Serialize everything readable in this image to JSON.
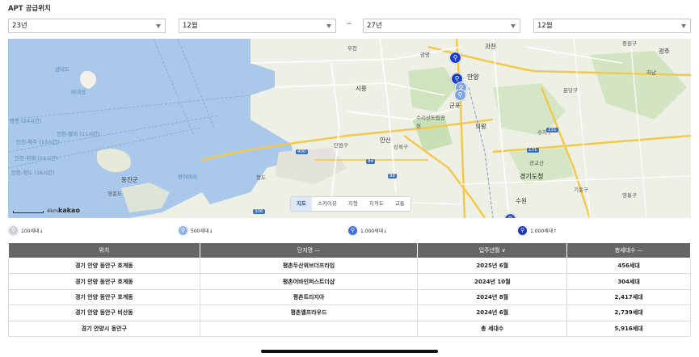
{
  "page": {
    "title": "APT 공급위치"
  },
  "filters": {
    "start_year": "23년",
    "start_month": "12월",
    "separator": "~",
    "end_year": "27년",
    "end_month": "12월"
  },
  "map": {
    "labels": [
      {
        "text": "삼미도",
        "kind": "sea"
      },
      {
        "text": "비내섬",
        "kind": "sea"
      },
      {
        "text": "영종 (24시간)",
        "kind": "sea"
      },
      {
        "text": "인천-팔미 (11시간)",
        "kind": "sea"
      },
      {
        "text": "인천-제주 (13시간)",
        "kind": "sea"
      },
      {
        "text": "인천-청도 (16시간)",
        "kind": "sea"
      },
      {
        "text": "인천-위해 (14시간)",
        "kind": "sea"
      },
      {
        "text": "옹진군",
        "kind": "city"
      },
      {
        "text": "영흥도",
        "kind": "normal"
      },
      {
        "text": "왕어머리",
        "kind": "sea"
      },
      {
        "text": "형도",
        "kind": "normal"
      },
      {
        "text": "시흥",
        "kind": "city"
      },
      {
        "text": "안산",
        "kind": "city"
      },
      {
        "text": "군포",
        "kind": "city"
      },
      {
        "text": "안양",
        "kind": "big"
      },
      {
        "text": "과천",
        "kind": "city"
      },
      {
        "text": "의왕",
        "kind": "city"
      },
      {
        "text": "수원",
        "kind": "city"
      },
      {
        "text": "경기도청",
        "kind": "big"
      },
      {
        "text": "단원구",
        "kind": "normal"
      },
      {
        "text": "상록구",
        "kind": "normal"
      },
      {
        "text": "수리산도립공원",
        "kind": "normal"
      },
      {
        "text": "부천",
        "kind": "normal"
      },
      {
        "text": "광명",
        "kind": "normal"
      },
      {
        "text": "분당구",
        "kind": "normal"
      },
      {
        "text": "수지구",
        "kind": "normal"
      },
      {
        "text": "기흥구",
        "kind": "normal"
      },
      {
        "text": "영통구",
        "kind": "normal"
      },
      {
        "text": "광주",
        "kind": "city"
      },
      {
        "text": "중원구",
        "kind": "normal"
      },
      {
        "text": "하남",
        "kind": "normal"
      },
      {
        "text": "광교산",
        "kind": "normal"
      }
    ],
    "road_signs": [
      "400",
      "84",
      "98",
      "306",
      "171",
      "331"
    ],
    "tabs": [
      {
        "label": "지도",
        "active": true
      },
      {
        "label": "스카이뷰",
        "active": false
      },
      {
        "label": "지형",
        "active": false
      },
      {
        "label": "지적도",
        "active": false
      },
      {
        "label": "교통",
        "active": false
      }
    ],
    "scale_label": "4km",
    "brand": "kakao",
    "markers": [
      {
        "icon": "apartment-pin-icon",
        "color": "#1a3fc9"
      },
      {
        "icon": "apartment-pin-icon",
        "color": "#1a3fc9"
      },
      {
        "icon": "apartment-pin-icon",
        "color": "#7ea3e0"
      },
      {
        "icon": "apartment-pin-icon",
        "color": "#7ea3e0"
      },
      {
        "icon": "apartment-pin-icon",
        "color": "#2e55d1"
      }
    ]
  },
  "legend": [
    {
      "label": "100세대↓",
      "color": "#c9ced6"
    },
    {
      "label": "500세대↓",
      "color": "#8fb0e6"
    },
    {
      "label": "1,000세대↓",
      "color": "#3f6fd8"
    },
    {
      "label": "1,000세대↑",
      "color": "#1a36b8"
    }
  ],
  "table": {
    "headers": [
      "위치",
      "단지명 —",
      "입주년월 ∨",
      "총세대수 —"
    ],
    "rows": [
      [
        "경기 안양 동안구 호계동",
        "평촌두산위브더프라임",
        "2025년 6월",
        "456세대"
      ],
      [
        "경기 안양 동안구 호계동",
        "평촌어바인퍼스트더샵",
        "2024년 10월",
        "304세대"
      ],
      [
        "경기 안양 동안구 호계동",
        "평촌트리지아",
        "2024년 8월",
        "2,417세대"
      ],
      [
        "경기 안양 동안구 비산동",
        "평촌엘프라우드",
        "2024년 6월",
        "2,739세대"
      ]
    ],
    "summary": {
      "location": "경기 안양시 동안구",
      "name": "",
      "label": "총 세대수",
      "total": "5,916세대"
    }
  },
  "colors": {
    "header_bg": "#666666",
    "water": "#a9c8ea",
    "land": "#eef0e6",
    "highway": "#f2c94c"
  }
}
